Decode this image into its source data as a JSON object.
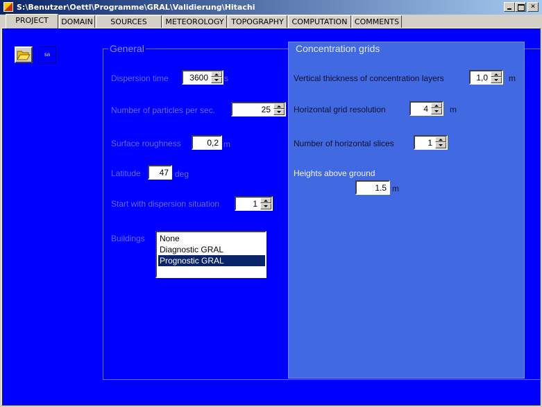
{
  "window": {
    "title": "S:\\Benutzer\\Oettl\\Programme\\GRAL\\Validierung\\Hitachi",
    "minimize_label": "",
    "maximize_label": "",
    "close_label": "✕"
  },
  "tabs": [
    "PROJECT",
    "DOMAIN",
    "SOURCES",
    "METEOROLOGY",
    "TOPOGRAPHY",
    "COMPUTATION",
    "COMMENTS"
  ],
  "active_tab": "PROJECT",
  "toolbar": {
    "open_icon": "folder-open-icon",
    "save_label": "sa"
  },
  "general": {
    "title": "General",
    "dispersion_time": {
      "label": "Dispersion time",
      "value": "3600",
      "unit": "s"
    },
    "particles": {
      "label": "Number of particles per sec.",
      "value": "25"
    },
    "roughness": {
      "label": "Surface roughness",
      "value": "0,2",
      "unit": "m"
    },
    "latitude": {
      "label": "Latitude",
      "value": "47",
      "unit": "deg"
    },
    "start_situation": {
      "label": "Start with dispersion situation",
      "value": "1"
    },
    "buildings": {
      "label": "Buildings",
      "options": [
        "None",
        "Diagnostic GRAL",
        "Prognostic GRAL"
      ],
      "selected": "Prognostic GRAL"
    }
  },
  "concentration": {
    "title": "Concentration grids",
    "vertical_thickness": {
      "label": "Vertical thickness of concentration layers",
      "value": "1,0",
      "unit": "m"
    },
    "horizontal_resolution": {
      "label": "Horizontal grid resolution",
      "value": "4",
      "unit": "m"
    },
    "horizontal_slices": {
      "label": "Number of horizontal slices",
      "value": "1"
    },
    "heights": {
      "label": "Heights above ground",
      "value": "1.5",
      "unit": "m"
    }
  },
  "colors": {
    "background": "#0000ff",
    "panel": "#4169e1",
    "chrome": "#d4d0c8",
    "selection": "#0a246a"
  }
}
